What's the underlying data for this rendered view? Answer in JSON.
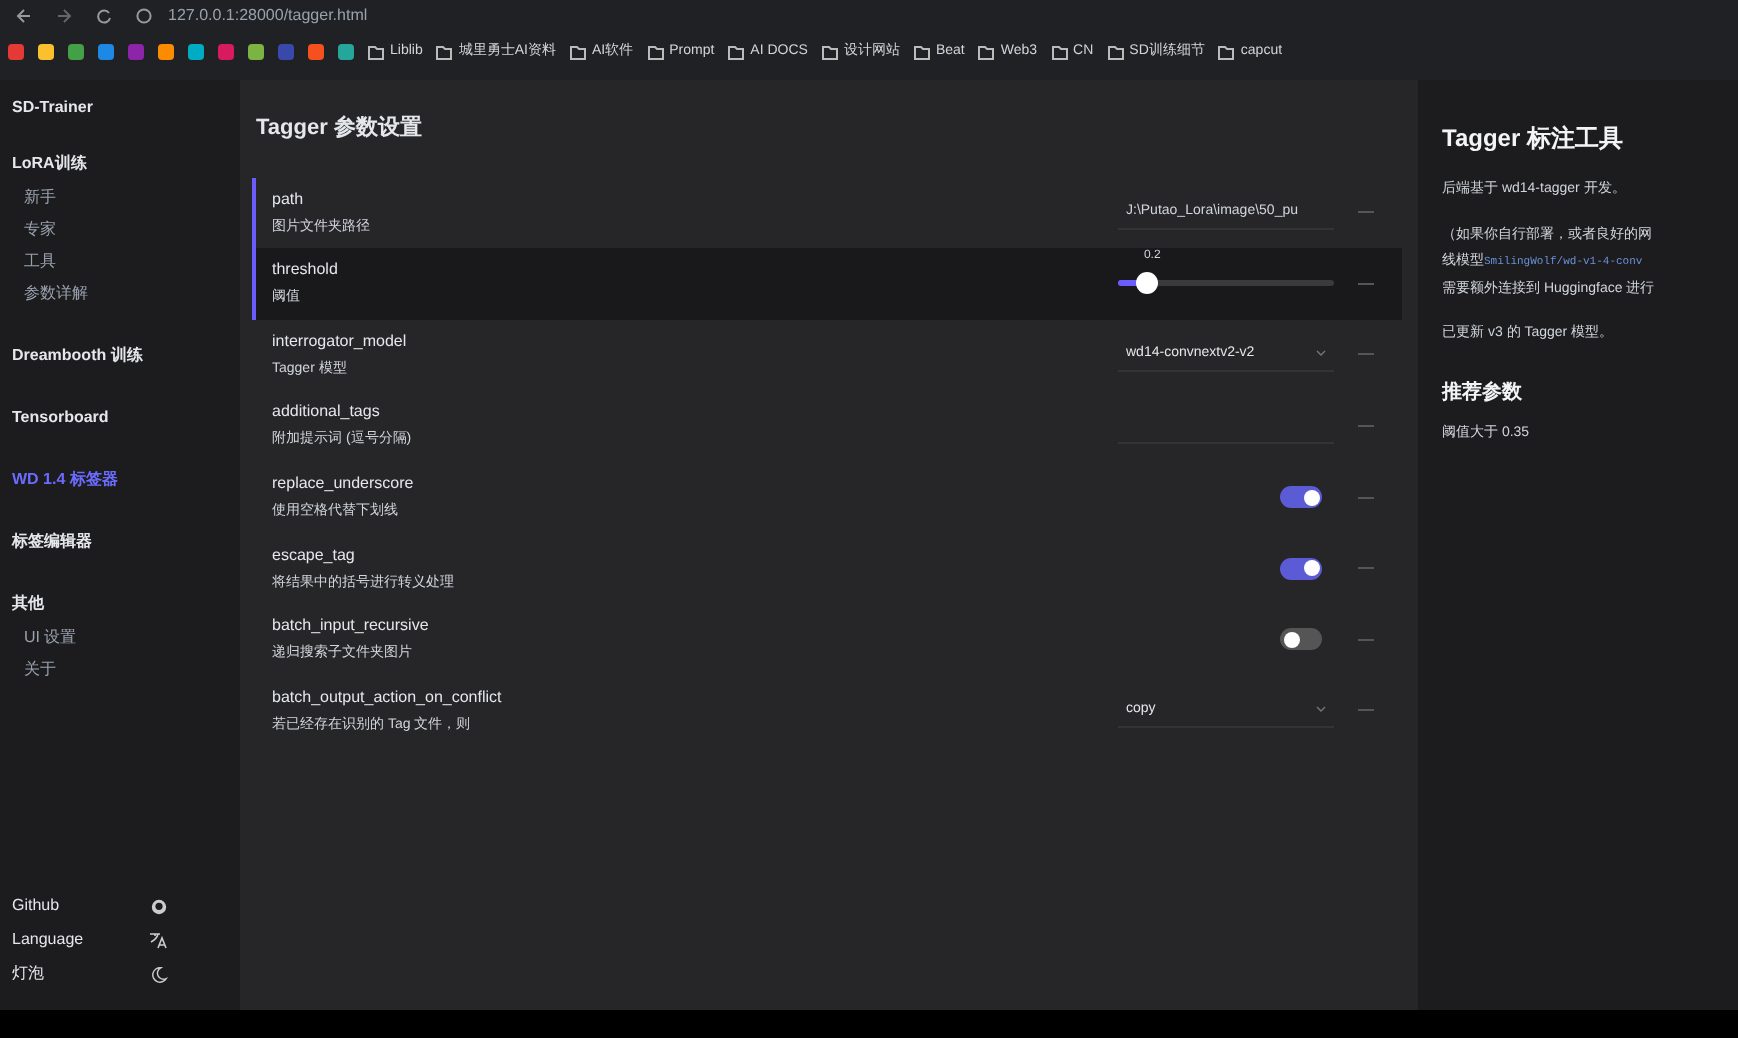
{
  "browser": {
    "url": "127.0.0.1:28000/tagger.html",
    "bookmarks": [
      {
        "label": "Liblib"
      },
      {
        "label": "城里勇士AI资料"
      },
      {
        "label": "AI软件"
      },
      {
        "label": "Prompt"
      },
      {
        "label": "AI DOCS"
      },
      {
        "label": "设计网站"
      },
      {
        "label": "Beat"
      },
      {
        "label": "Web3"
      },
      {
        "label": "CN"
      },
      {
        "label": "SD训练细节"
      },
      {
        "label": "capcut"
      }
    ]
  },
  "sidebar": {
    "title": "SD-Trainer",
    "sections": [
      {
        "label": "LoRA训练",
        "selected": false,
        "children": [
          {
            "label": "新手",
            "selected": false
          },
          {
            "label": "专家",
            "selected": false
          },
          {
            "label": "工具",
            "selected": false
          },
          {
            "label": "参数详解",
            "selected": false
          }
        ]
      },
      {
        "label": "Dreambooth 训练",
        "selected": false
      },
      {
        "label": "Tensorboard",
        "selected": false
      },
      {
        "label": "WD 1.4 标签器",
        "selected": true
      },
      {
        "label": "标签编辑器",
        "selected": false
      },
      {
        "label": "其他",
        "selected": false,
        "children": [
          {
            "label": "UI 设置",
            "selected": false
          },
          {
            "label": "关于",
            "selected": false
          }
        ]
      }
    ],
    "footer": [
      {
        "label": "Github"
      },
      {
        "label": "Language"
      },
      {
        "label": "灯泡"
      }
    ]
  },
  "settings": {
    "title": "Tagger 参数设置",
    "rows": [
      {
        "name": "path",
        "description": "图片文件夹路径",
        "kind": "text",
        "value": "J:\\Putao_Lora\\image\\50_pu",
        "highlighted": false,
        "accent": true
      },
      {
        "name": "threshold",
        "description": "阈值",
        "kind": "slider",
        "reading": "0.2",
        "level": 0.1,
        "highlighted": true,
        "accent": true
      },
      {
        "name": "interrogator_model",
        "description": "Tagger 模型",
        "kind": "select",
        "value": "wd14-convnextv2-v2",
        "highlighted": false,
        "accent": false
      },
      {
        "name": "additional_tags",
        "description": "附加提示词 (逗号分隔)",
        "kind": "text",
        "value": "",
        "highlighted": false,
        "accent": false
      },
      {
        "name": "replace_underscore",
        "description": "使用空格代替下划线",
        "kind": "toggle",
        "on": true,
        "highlighted": false,
        "accent": false
      },
      {
        "name": "escape_tag",
        "description": "将结果中的括号进行转义处理",
        "kind": "toggle",
        "on": true,
        "highlighted": false,
        "accent": false
      },
      {
        "name": "batch_input_recursive",
        "description": "递归搜索子文件夹图片",
        "kind": "toggle",
        "on": false,
        "highlighted": false,
        "accent": false
      },
      {
        "name": "batch_output_action_on_conflict",
        "description": "若已经存在识别的 Tag 文件，则",
        "kind": "select",
        "value": "copy",
        "highlighted": false,
        "accent": false
      }
    ]
  },
  "info": {
    "title": "Tagger 标注工具",
    "paragraphs": [
      {
        "kind": "text",
        "text": "后端基于 wd14-tagger 开发。"
      },
      {
        "kind": "lines",
        "lines": [
          {
            "text": "（如果你自行部署，或者良好的网"
          },
          {
            "text": "线模型 ",
            "code": "SmilingWolf/wd-v1-4-conv"
          },
          {
            "text": "需要额外连接到 Huggingface 进行"
          }
        ]
      },
      {
        "kind": "text",
        "text": "已更新 v3 的 Tagger 模型。"
      }
    ],
    "subtitle": "推荐参数",
    "note": "阈值大于 0.35"
  }
}
